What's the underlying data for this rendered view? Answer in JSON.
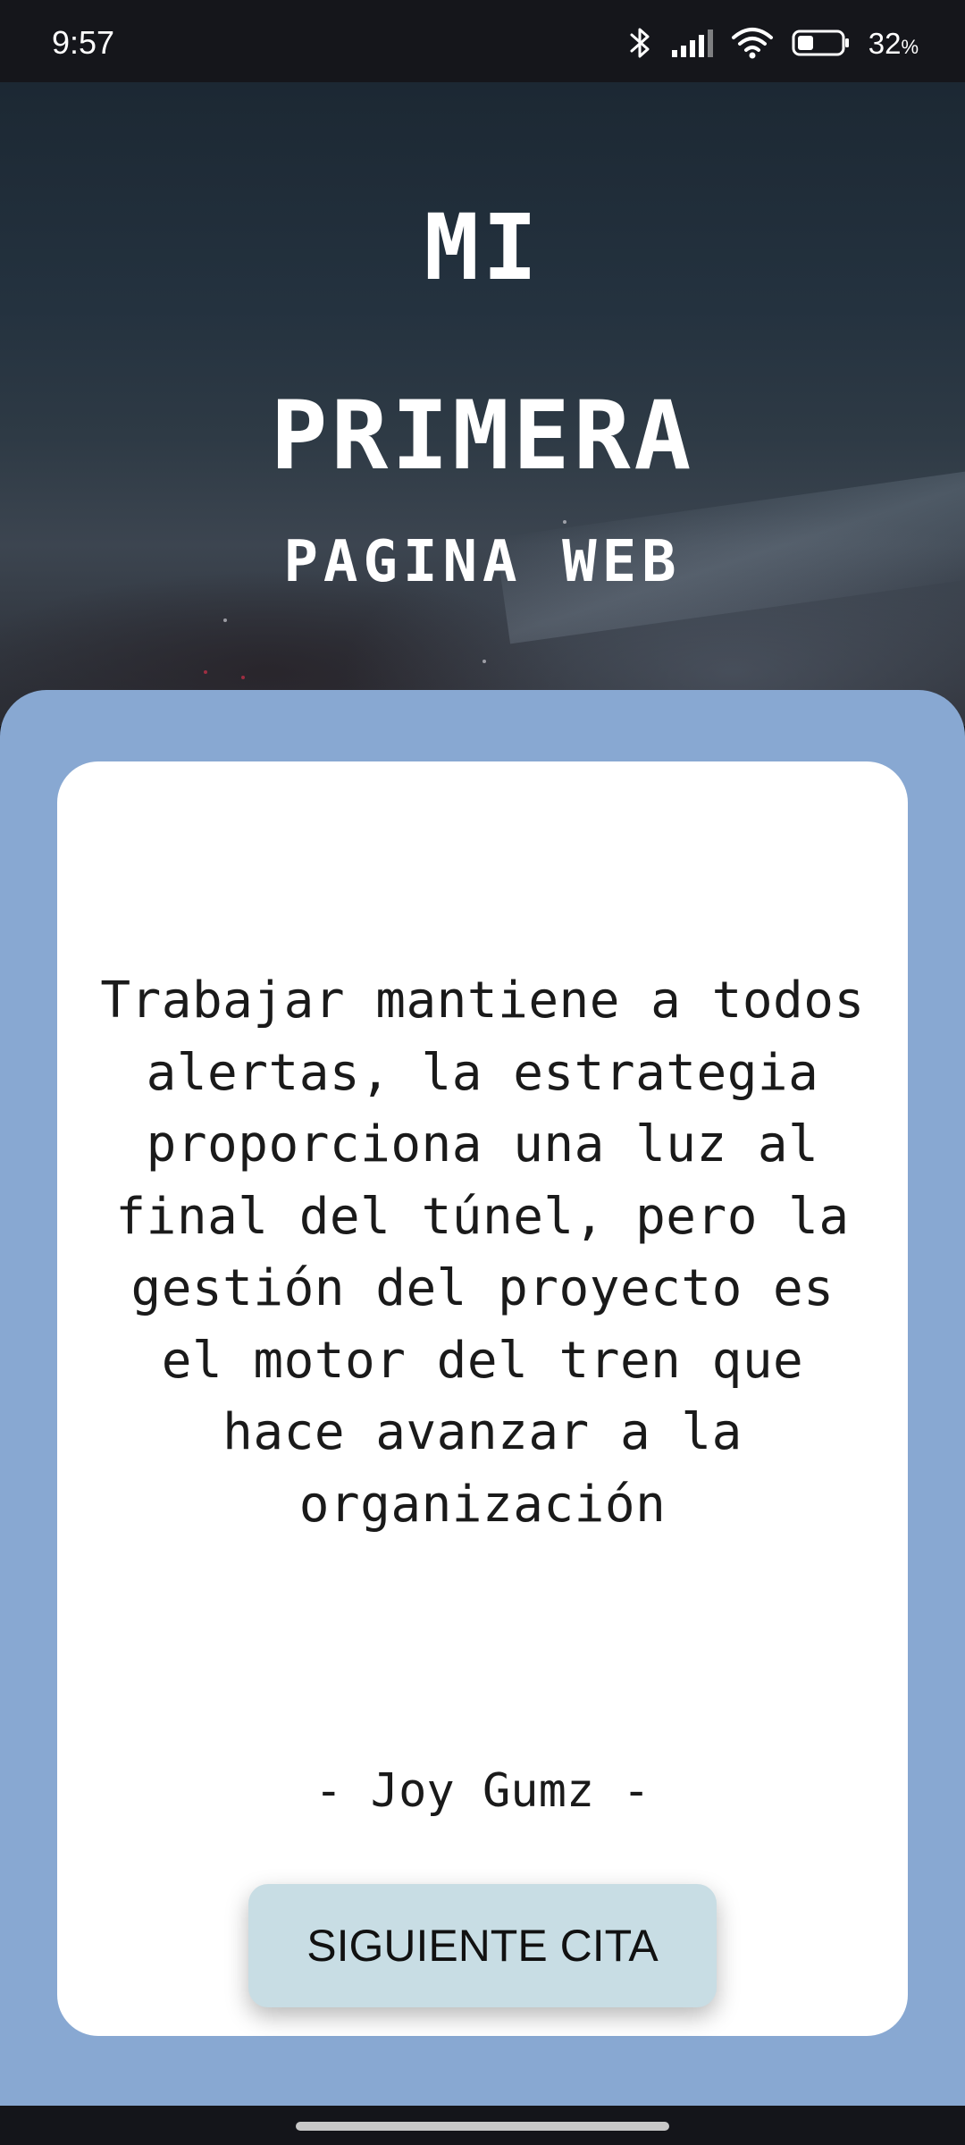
{
  "status_bar": {
    "time": "9:57",
    "battery_percent": "32",
    "battery_unit": "%",
    "icons": [
      "bluetooth-icon",
      "signal-icon",
      "wifi-icon",
      "battery-icon"
    ]
  },
  "hero": {
    "title_line1": "MI",
    "title_line2": "PRIMERA",
    "subtitle": "PAGINA WEB"
  },
  "quote_card": {
    "quote": "Trabajar mantiene a todos\nalertas, la estrategia\nproporciona una luz al\nfinal del túnel, pero la\ngestión del proyecto es\nel motor del tren que\nhace avanzar a la\norganización",
    "author": "- Joy Gumz -",
    "button_label": "SIGUIENTE CITA"
  },
  "colors": {
    "panel": "#88a8d2",
    "card": "#ffffff",
    "button": "#c8dde4",
    "status_bar": "#15161b"
  }
}
